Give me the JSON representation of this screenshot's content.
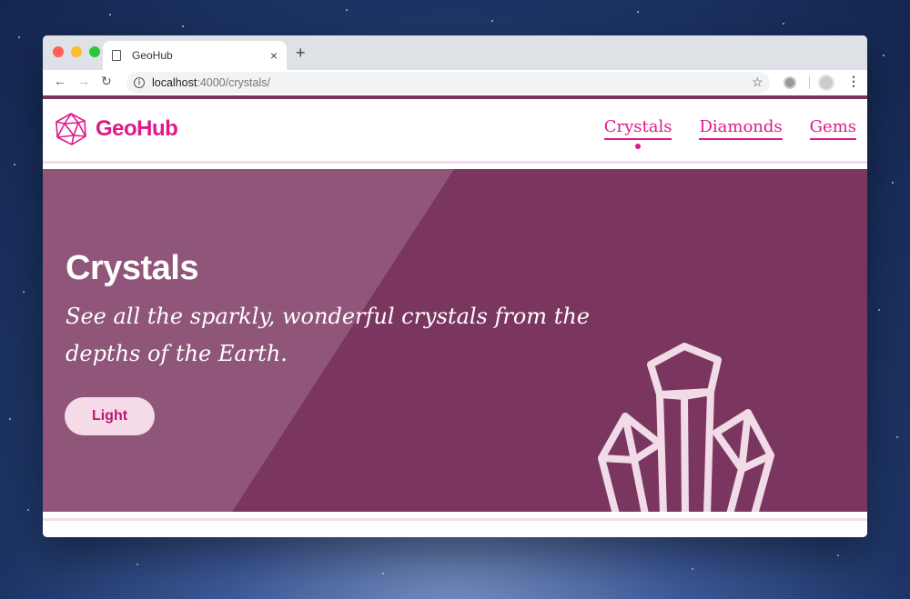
{
  "browser": {
    "tab_title": "GeoHub",
    "tab_close": "×",
    "new_tab": "+",
    "url_host": "localhost",
    "url_path": ":4000/crystals/",
    "back": "←",
    "forward": "→",
    "reload": "↻",
    "bookmark": "☆",
    "menu": "⋮",
    "info": "i"
  },
  "site": {
    "logo_text": "GeoHub",
    "nav": [
      {
        "label": "Crystals",
        "active": true
      },
      {
        "label": "Diamonds",
        "active": false
      },
      {
        "label": "Gems",
        "active": false
      }
    ]
  },
  "hero": {
    "title": "Crystals",
    "subtitle": "See all the sparkly, wonderful crystals from the depths of the Earth.",
    "button_label": "Light"
  },
  "colors": {
    "brand": "#e0198a",
    "hero_bg": "#7b3660",
    "button_bg": "#f5dbe8"
  },
  "icons": {
    "logo": "icosahedron-logo-icon",
    "crystal": "crystal-cluster-illustration"
  }
}
